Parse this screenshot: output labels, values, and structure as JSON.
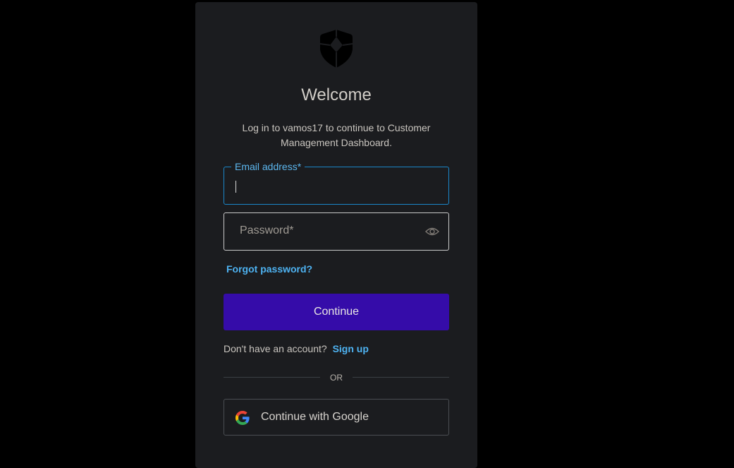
{
  "header": {
    "logo_icon": "shield-logo-icon",
    "title": "Welcome",
    "subtitle": "Log in to vamos17 to continue to Customer Management Dashboard."
  },
  "form": {
    "email_label": "Email address*",
    "email_value": "",
    "password_placeholder": "Password*",
    "password_toggle_icon": "eye-icon",
    "forgot_password": "Forgot password?",
    "continue_label": "Continue"
  },
  "signup": {
    "prompt": "Don't have an account?",
    "link": "Sign up"
  },
  "divider": {
    "text": "OR"
  },
  "social": {
    "google_label": "Continue with Google",
    "google_icon": "google-icon"
  },
  "colors": {
    "background": "#000000",
    "card": "#1b1c1f",
    "accent": "#350ca9",
    "link": "#4eb3f2",
    "focus_border": "#1b87c9"
  }
}
